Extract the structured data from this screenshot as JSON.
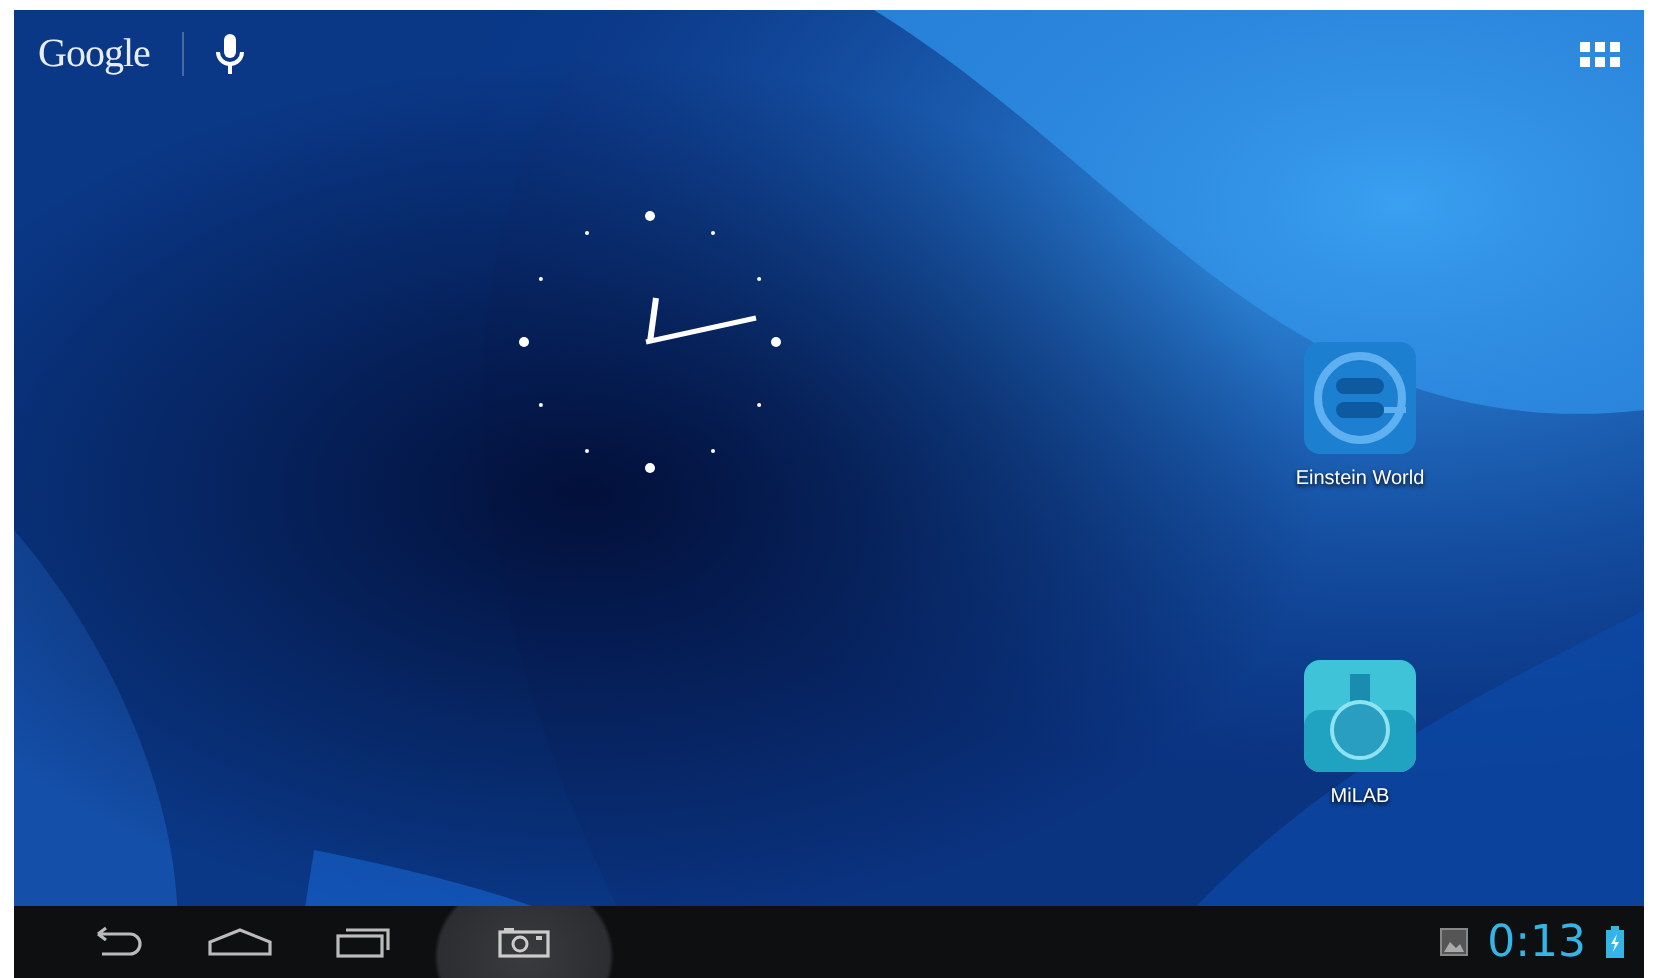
{
  "search_bar": {
    "label": "Google"
  },
  "apps": [
    {
      "label": "Einstein World",
      "kind": "einstein"
    },
    {
      "label": "MiLAB",
      "kind": "milab"
    }
  ],
  "status_bar": {
    "time": "0:13"
  }
}
